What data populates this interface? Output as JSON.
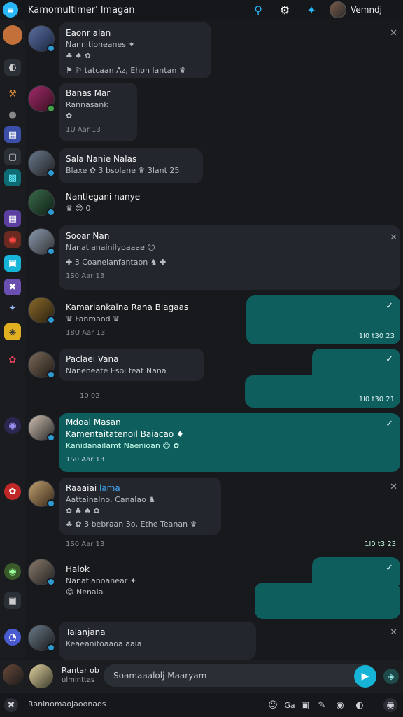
{
  "window": {
    "title": "Kamomultimer' lmagan"
  },
  "topbar": {
    "user_name": "Vemndj"
  },
  "rail": [
    "A",
    "◐",
    "⚒",
    "▦",
    "▢",
    "▩",
    "▦",
    "◆",
    "◉",
    "✦",
    "☘",
    "✪",
    "❖",
    "◎",
    "✿",
    "◉",
    "▣",
    "◔"
  ],
  "messages": [
    {
      "name": "Eaonr alan",
      "line1": "Nannitioneanes ✦",
      "line2": "♣ ♠ ✿",
      "line3": "⚑ ⚐ tatcaan Az, Ehon lantan ♛",
      "meta": ""
    },
    {
      "name": "Banas Mar",
      "line1": "Rannasank",
      "line2": "✿",
      "meta": "1U Aar 13"
    },
    {
      "name": "Sala Nanie Nalas",
      "line1": "Blaxe ✿ 3 bsolane ♛ 3lant 25",
      "meta": ""
    },
    {
      "name": "Nantlegani nanye",
      "line1": "♛ 😎 0",
      "meta": ""
    },
    {
      "name": "Sooar Nan",
      "line1": "Nanatianainilyoaaae 😊",
      "line2": "✚ 3 Coanelanfantaon ♞ ✚",
      "meta": "1S0 Aar 13"
    },
    {
      "name": "Kamarlankalna Rana Biagaas",
      "line1": "♛ Fanmaod ♛",
      "meta": "18U Aar 13"
    },
    {
      "name": "Paclaei Vana",
      "line1": "Naneneate Esoi feat Nana",
      "meta": "10 02"
    },
    {
      "name": "Mdoal Masan",
      "line1": "Kamentaitatenoil Baiacao ♦",
      "line2": "Kanidanailamt Naenioan 😊 ✿",
      "meta": "1S0 Aar 13"
    },
    {
      "name": "Raaaiai",
      "tag": "lama",
      "line1": "Aattainalno, Canalao ♞",
      "line2": "✿ ♣ ♠ ✿",
      "line3": "♣ ✿ 3 bebraan 3o, Ethe Teanan ♛",
      "meta": "1S0 Aar 13"
    },
    {
      "name": "Halok",
      "line1": "Nanatianoanear ✦",
      "line2": "😊 Nenaia",
      "meta": ""
    },
    {
      "name": "Talanjana",
      "line1": "Keaeanitoaaoa aaia",
      "meta": ""
    }
  ],
  "teal_metas": [
    "1l0 t30 23",
    "1l0 t30 21",
    "",
    "1l0 t3 23",
    ""
  ],
  "composer": {
    "placeholder": "Soamaaalolj Maaryam",
    "left_name": "Rantar ob",
    "left_sub": "ulminttas"
  },
  "bottombar": {
    "status": "Raninomaojaoonaos",
    "icons": [
      "Ga",
      "▣"
    ]
  }
}
